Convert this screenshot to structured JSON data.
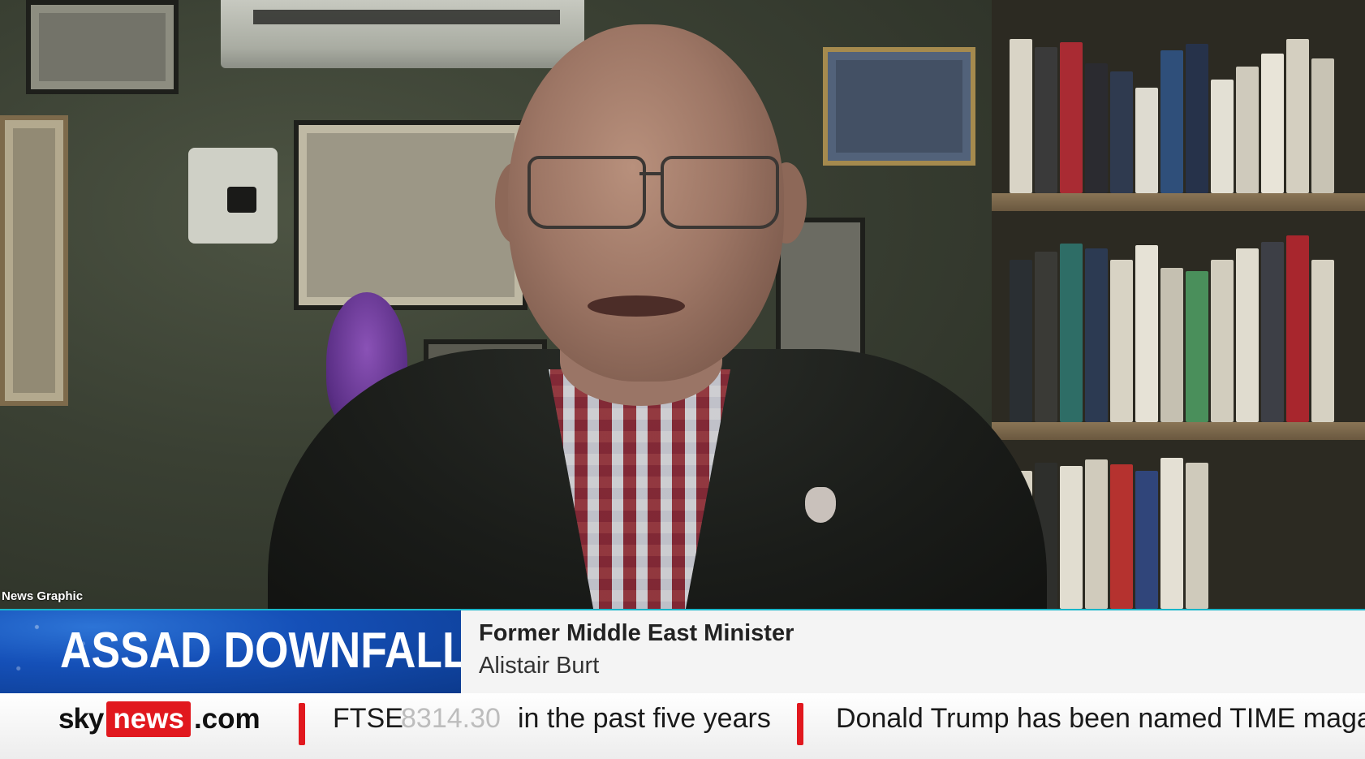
{
  "overlay": {
    "bug_label": "News Graphic"
  },
  "lower_third": {
    "headline": "ASSAD DOWNFALL",
    "guest_title": "Former Middle East Minister",
    "guest_name": "Alistair Burt"
  },
  "ticker": {
    "brand_sky": "sky",
    "brand_news": "news",
    "brand_com": ".com",
    "market_name": "FTSE",
    "market_value": "8314.30",
    "headline_1": "in the past five years",
    "headline_2": "Donald Trump has been named TIME magazi"
  },
  "colors": {
    "accent_teal": "#18b6c9",
    "brand_red": "#e1181e",
    "headline_blue": "#1550b8"
  }
}
